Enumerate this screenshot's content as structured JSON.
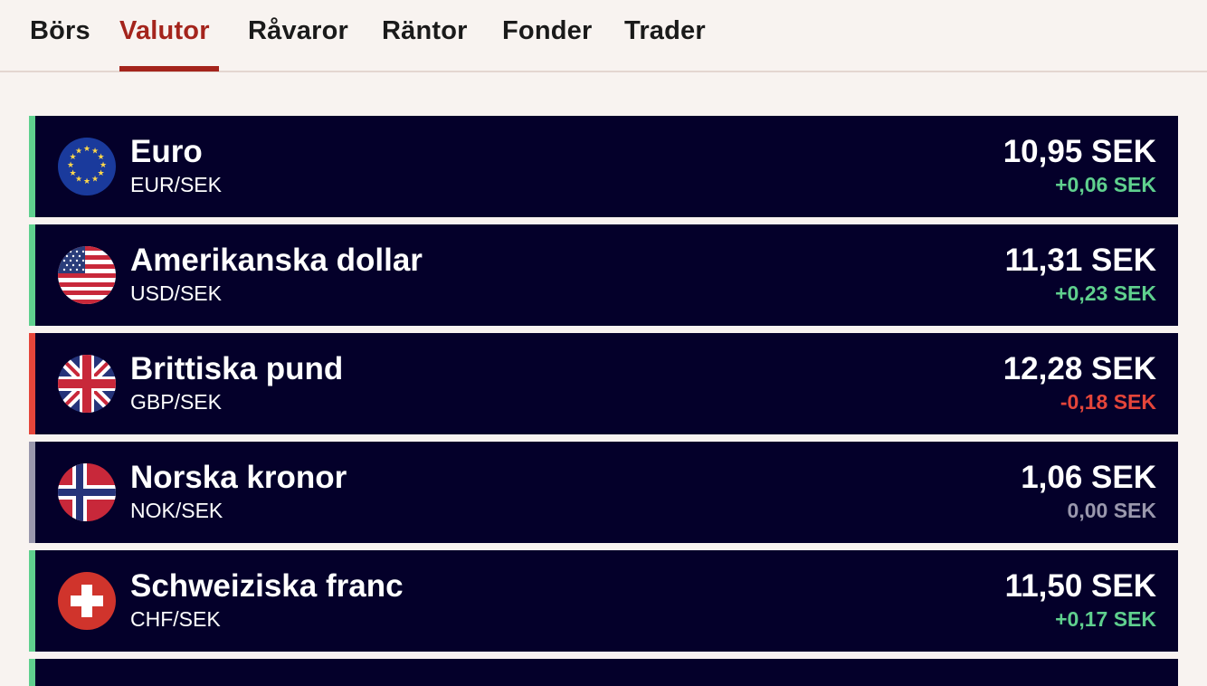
{
  "tabs": [
    {
      "label": "Börs",
      "active": false
    },
    {
      "label": "Valutor",
      "active": true
    },
    {
      "label": "Råvaror",
      "active": false
    },
    {
      "label": "Räntor",
      "active": false
    },
    {
      "label": "Fonder",
      "active": false
    },
    {
      "label": "Trader",
      "active": false
    }
  ],
  "colors": {
    "accent": "#a4241c",
    "row_bg": "#04002a",
    "positive": "#5fd08e",
    "negative": "#e5453a",
    "neutral": "#9a98ad"
  },
  "currencies": [
    {
      "name": "Euro",
      "pair": "EUR/SEK",
      "price": "10,95 SEK",
      "change": "+0,06 SEK",
      "trend": "up",
      "flag": "eu-flag-icon"
    },
    {
      "name": "Amerikanska dollar",
      "pair": "USD/SEK",
      "price": "11,31 SEK",
      "change": "+0,23 SEK",
      "trend": "up",
      "flag": "us-flag-icon"
    },
    {
      "name": "Brittiska pund",
      "pair": "GBP/SEK",
      "price": "12,28 SEK",
      "change": "-0,18 SEK",
      "trend": "down",
      "flag": "uk-flag-icon"
    },
    {
      "name": "Norska kronor",
      "pair": "NOK/SEK",
      "price": "1,06 SEK",
      "change": "0,00 SEK",
      "trend": "flat",
      "flag": "norway-flag-icon"
    },
    {
      "name": "Schweiziska franc",
      "pair": "CHF/SEK",
      "price": "11,50 SEK",
      "change": "+0,17 SEK",
      "trend": "up",
      "flag": "swiss-flag-icon"
    }
  ]
}
